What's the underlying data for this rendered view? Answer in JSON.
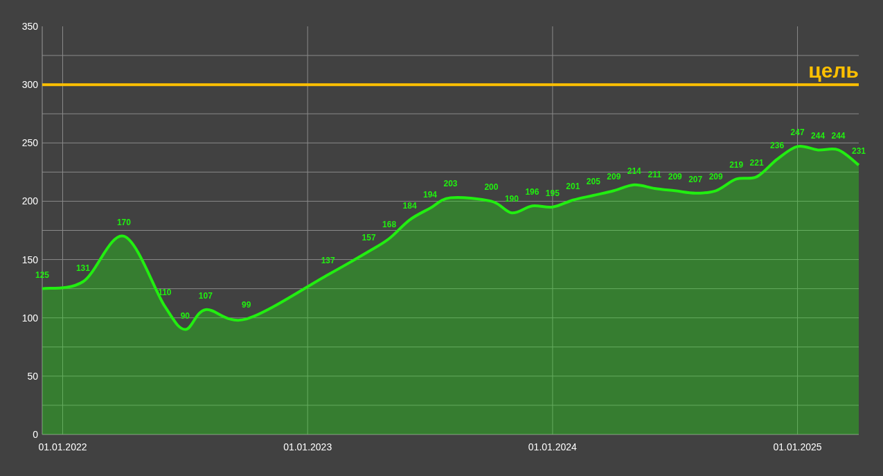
{
  "chart": {
    "chart_data": {
      "type": "area",
      "categories": [
        null,
        "01.01.2022",
        null,
        null,
        null,
        null,
        null,
        null,
        null,
        null,
        null,
        null,
        null,
        "01.01.2023",
        null,
        null,
        null,
        null,
        null,
        null,
        null,
        null,
        null,
        null,
        null,
        "01.01.2024",
        null,
        null,
        null,
        null,
        null,
        null,
        null,
        null,
        null,
        null,
        null,
        "01.01.2025",
        null,
        null,
        null
      ],
      "series": [
        {
          "color": "#22ee11",
          "values": [
            125,
            null,
            131,
            null,
            170,
            null,
            110,
            90,
            107,
            null,
            99,
            null,
            null,
            null,
            137,
            null,
            157,
            168,
            184,
            194,
            203,
            null,
            200,
            190,
            196,
            195,
            201,
            205,
            209,
            214,
            211,
            209,
            207,
            209,
            219,
            221,
            236,
            247,
            244,
            244,
            231
          ]
        }
      ],
      "ylim": [
        0,
        350
      ],
      "yticks": [
        0,
        50,
        100,
        150,
        200,
        250,
        300,
        350
      ],
      "data_labels": true,
      "grid": true,
      "ref_lines": [
        {
          "axis": "y",
          "value": 300,
          "label": "цель",
          "color": "#ffc000"
        }
      ]
    }
  }
}
